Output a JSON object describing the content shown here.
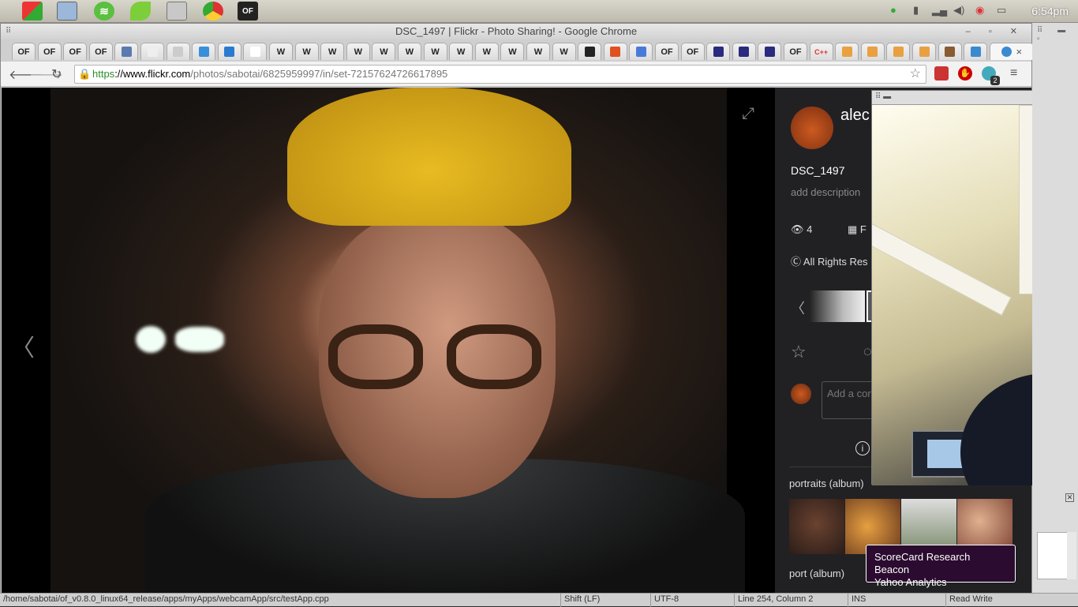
{
  "system_bar": {
    "launchers": [
      "windows-logo-icon",
      "desktop-icon",
      "spotify-icon",
      "leaf-icon",
      "files-icon",
      "chrome-icon",
      "of-app-icon"
    ],
    "tray_icons": [
      "spotify-tray-icon",
      "battery-icon",
      "signal-icon",
      "volume-icon",
      "chrome-tray-icon",
      "network-icon"
    ],
    "clock": "6:54pm"
  },
  "browser": {
    "window_title": "DSC_1497 | Flickr - Photo Sharing! - Google Chrome",
    "window_buttons": "‒ ▫ ✕",
    "tabs": [
      "OF",
      "OF",
      "OF",
      "OF",
      "",
      "",
      "",
      "",
      "",
      "",
      "W",
      "W",
      "W",
      "W",
      "W",
      "W",
      "W",
      "W",
      "W",
      "W",
      "W",
      "W",
      "",
      "",
      "",
      "OF",
      "OF",
      "",
      "",
      "",
      "OF",
      "C++",
      "",
      "",
      "",
      "",
      "",
      ""
    ],
    "active_tab_close": "×",
    "url_scheme": "https",
    "url_host": "://www.flickr.com",
    "url_path": "/photos/sabotai/6825959997/in/set-72157624726617895",
    "extension_badge": "2"
  },
  "flickr": {
    "owner": "alec",
    "photo_title": "DSC_1497",
    "add_description": "add description",
    "views": "4",
    "date_fragment": "F",
    "license": "All Rights Res",
    "comment_placeholder": "Add a cor",
    "album1": "portraits (album)",
    "album2": "port (album)"
  },
  "tooltip": {
    "line1": "ScoreCard Research Beacon",
    "line2": "Yahoo Analytics"
  },
  "status_bar": {
    "path": "/home/sabotai/of_v0.8.0_linux64_release/apps/myApps/webcamApp/src/testApp.cpp",
    "encoding": "Shift (LF)",
    "charset": "UTF-8",
    "position": "Line 254, Column 2",
    "mode": "INS",
    "extra": "Read Write"
  },
  "colors": {
    "flickr_bg": "#212124",
    "secure_green": "#2a8f2a",
    "tooltip_bg": "#2b0b2f",
    "beanie_yellow": "#e8bb22"
  }
}
